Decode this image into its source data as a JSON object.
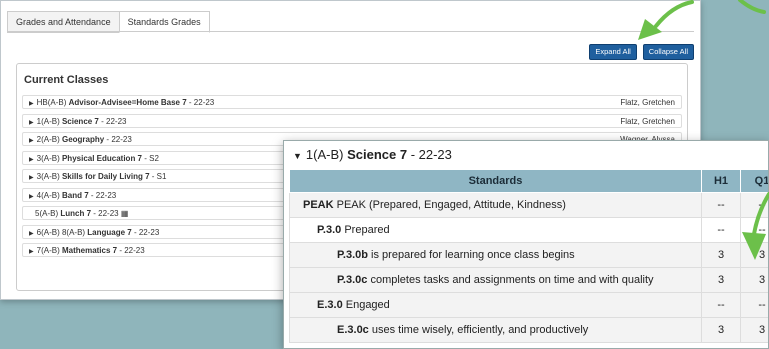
{
  "tabs": [
    "Grades and Attendance",
    "Standards Grades"
  ],
  "buttons": {
    "expand": "Expand All",
    "collapse": "Collapse All"
  },
  "current_classes": {
    "title": "Current Classes",
    "rows": [
      {
        "prefix": "HB(A-B) ",
        "name": "Advisor-Advisee=Home Base 7",
        "suffix": " - 22-23",
        "teacher": "Flatz, Gretchen",
        "arrow": true
      },
      {
        "prefix": "1(A-B) ",
        "name": "Science 7",
        "suffix": " - 22-23",
        "teacher": "Flatz, Gretchen",
        "arrow": true
      },
      {
        "prefix": "2(A-B) ",
        "name": "Geography",
        "suffix": " - 22-23",
        "teacher": "Wagner, Alyssa",
        "arrow": true
      },
      {
        "prefix": "3(A-B) ",
        "name": "Physical Education 7",
        "suffix": " - S2",
        "teacher": "",
        "arrow": true
      },
      {
        "prefix": "3(A-B) ",
        "name": "Skills for Daily Living 7",
        "suffix": " - S1",
        "teacher": "",
        "arrow": true
      },
      {
        "prefix": "4(A-B) ",
        "name": "Band 7",
        "suffix": " - 22-23",
        "teacher": "",
        "arrow": true
      },
      {
        "prefix": "5(A-B) ",
        "name": "Lunch 7",
        "suffix": " - 22-23",
        "teacher": "",
        "arrow": false,
        "calendar": true
      },
      {
        "prefix": "6(A-B) 8(A-B) ",
        "name": "Language 7",
        "suffix": " - 22-23",
        "teacher": "",
        "arrow": true
      },
      {
        "prefix": "7(A-B) ",
        "name": "Mathematics 7",
        "suffix": " - 22-23",
        "teacher": "",
        "arrow": true
      }
    ]
  },
  "detail": {
    "prefix": "1(A-B) ",
    "name": "Science 7",
    "suffix": " - 22-23",
    "headers": [
      "Standards",
      "H1",
      "Q1"
    ],
    "rows": [
      {
        "level": 0,
        "code": "PEAK",
        "text": " PEAK (Prepared, Engaged, Attitude, Kindness)",
        "h1": "--",
        "q1": "--"
      },
      {
        "level": 1,
        "code": "P.3.0",
        "text": " Prepared",
        "h1": "--",
        "q1": "--"
      },
      {
        "level": 2,
        "code": "P.3.0b",
        "text": " is prepared for learning once class begins",
        "h1": "3",
        "q1": "3"
      },
      {
        "level": 2,
        "code": "P.3.0c",
        "text": " completes tasks and assignments on time and with quality",
        "h1": "3",
        "q1": "3"
      },
      {
        "level": 1,
        "code": "E.3.0",
        "text": " Engaged",
        "h1": "--",
        "q1": "--"
      },
      {
        "level": 2,
        "code": "E.3.0c",
        "text": " uses time wisely, efficiently, and productively",
        "h1": "3",
        "q1": "3"
      }
    ]
  },
  "colors": {
    "accent": "#1f5f9e",
    "header_bg": "#8fb6c4",
    "arrow": "#6cc04a",
    "background": "#8fb5bb",
    "dots": "#cf5a22"
  }
}
